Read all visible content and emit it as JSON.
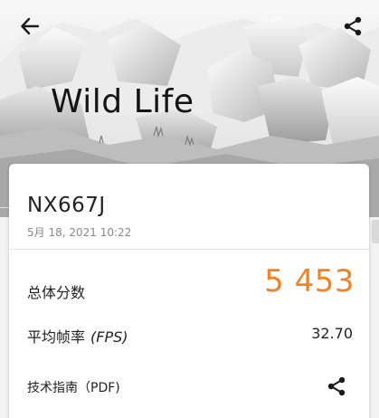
{
  "header": {
    "back_icon": "arrow-left-icon",
    "share_icon": "share-icon"
  },
  "hero": {
    "title": "Wild Life"
  },
  "result": {
    "device": "NX667J",
    "timestamp": "5月 18, 2021 10:22",
    "score_label": "总体分数",
    "score_value": "5 453",
    "fps_label": "平均帧率",
    "fps_unit": "(FPS)",
    "fps_value": "32.70",
    "guide_label": "技术指南（PDF)",
    "guide_share_icon": "share-icon"
  },
  "colors": {
    "score": "#f58220",
    "text": "#222222",
    "muted": "#8a8a8a"
  }
}
